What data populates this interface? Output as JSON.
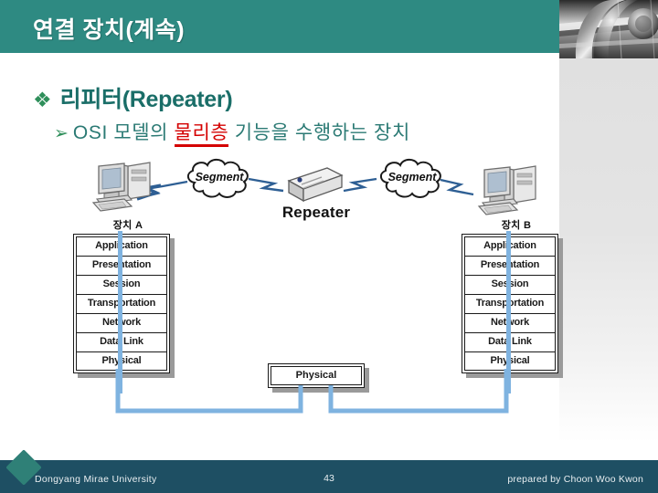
{
  "header": {
    "title": "연결 장치(계속)",
    "bar_color": "#2e8a82"
  },
  "corner_photo": {
    "name": "metallic-pipe-photo"
  },
  "bullets": {
    "level1": {
      "glyph": "❖",
      "text": "리피터(Repeater)",
      "color": "#1a6e68"
    },
    "level2": {
      "glyph": "➢",
      "prefix": "OSI 모델의 ",
      "highlight": "물리층",
      "suffix": " 기능을 수행하는 장치",
      "color": "#2b7a74",
      "highlight_color": "#d40000"
    }
  },
  "diagram": {
    "device_a_label": "장치 A",
    "device_b_label": "장치 B",
    "segment_left_label": "Segment",
    "segment_right_label": "Segment",
    "repeater_label": "Repeater",
    "middle_box_label": "Physical",
    "link_color": "#2e5f94",
    "stack_line_color": "#7fb3e0",
    "osi_layers": [
      "Application",
      "Presentation",
      "Session",
      "Transportation",
      "Network",
      "Data Link",
      "Physical"
    ]
  },
  "footer": {
    "organization": "Dongyang Mirae University",
    "page_number": "43",
    "author": "prepared by Choon Woo Kwon",
    "bar_color": "#1e4f63",
    "logo_color": "#2f8077"
  }
}
